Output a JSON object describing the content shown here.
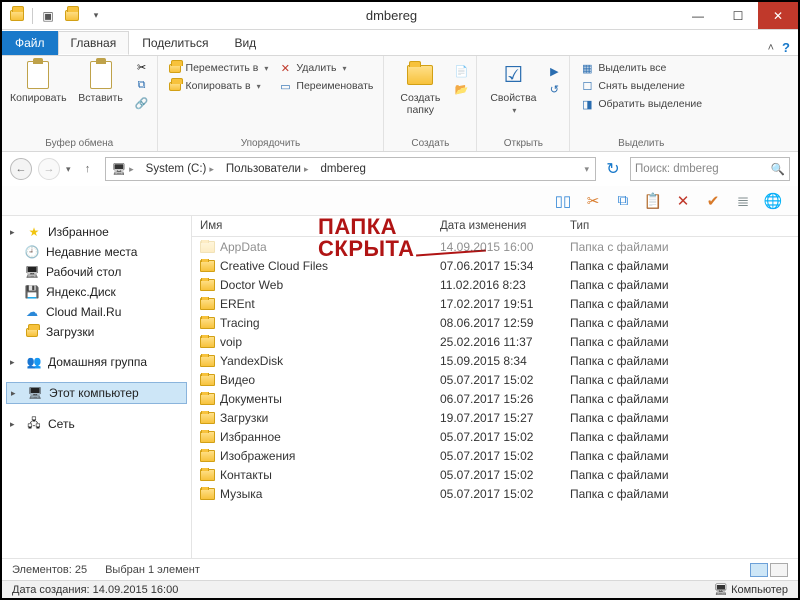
{
  "window": {
    "title": "dmbereg"
  },
  "tabs": {
    "file": "Файл",
    "home": "Главная",
    "share": "Поделиться",
    "view": "Вид"
  },
  "ribbon": {
    "clipboard": {
      "copy": "Копировать",
      "paste": "Вставить",
      "label": "Буфер обмена"
    },
    "organize": {
      "move": "Переместить в",
      "copy_to": "Копировать в",
      "delete": "Удалить",
      "rename": "Переименовать",
      "label": "Упорядочить"
    },
    "new": {
      "new_folder": "Создать\nпапку",
      "label": "Создать"
    },
    "open": {
      "properties": "Свойства",
      "label": "Открыть"
    },
    "select": {
      "all": "Выделить все",
      "none": "Снять выделение",
      "invert": "Обратить выделение",
      "label": "Выделить"
    }
  },
  "breadcrumbs": [
    "System (C:)",
    "Пользователи",
    "dmbereg"
  ],
  "search": {
    "placeholder": "Поиск: dmbereg"
  },
  "nav": {
    "favorites": {
      "title": "Избранное",
      "items": [
        "Недавние места",
        "Рабочий стол",
        "Яндекс.Диск",
        "Cloud Mail.Ru",
        "Загрузки"
      ]
    },
    "homegroup": "Домашняя группа",
    "this_pc": "Этот компьютер",
    "network": "Сеть"
  },
  "columns": {
    "name": "Имя",
    "date": "Дата изменения",
    "type": "Тип"
  },
  "type_folder": "Папка с файлами",
  "files": [
    {
      "name": "AppData",
      "date": "14.09.2015 16:00",
      "hidden": true
    },
    {
      "name": "Creative Cloud Files",
      "date": "07.06.2017 15:34"
    },
    {
      "name": "Doctor Web",
      "date": "11.02.2016 8:23"
    },
    {
      "name": "EREnt",
      "date": "17.02.2017 19:51"
    },
    {
      "name": "Tracing",
      "date": "08.06.2017 12:59"
    },
    {
      "name": "voip",
      "date": "25.02.2016 11:37"
    },
    {
      "name": "YandexDisk",
      "date": "15.09.2015 8:34"
    },
    {
      "name": "Видео",
      "date": "05.07.2017 15:02"
    },
    {
      "name": "Документы",
      "date": "06.07.2017 15:26"
    },
    {
      "name": "Загрузки",
      "date": "19.07.2017 15:27"
    },
    {
      "name": "Избранное",
      "date": "05.07.2017 15:02"
    },
    {
      "name": "Изображения",
      "date": "05.07.2017 15:02"
    },
    {
      "name": "Контакты",
      "date": "05.07.2017 15:02"
    },
    {
      "name": "Музыка",
      "date": "05.07.2017 15:02"
    }
  ],
  "status": {
    "count_label": "Элементов:",
    "count": "25",
    "selected": "Выбран 1 элемент"
  },
  "status2": {
    "created_label": "Дата создания:",
    "created": "14.09.2015 16:00",
    "computer": "Компьютер"
  },
  "annotation": {
    "line1": "ПАПКА",
    "line2": "СКРЫТА"
  },
  "colors": {
    "accent": "#1979ca",
    "close": "#c0392b",
    "annotation": "#b01414"
  }
}
